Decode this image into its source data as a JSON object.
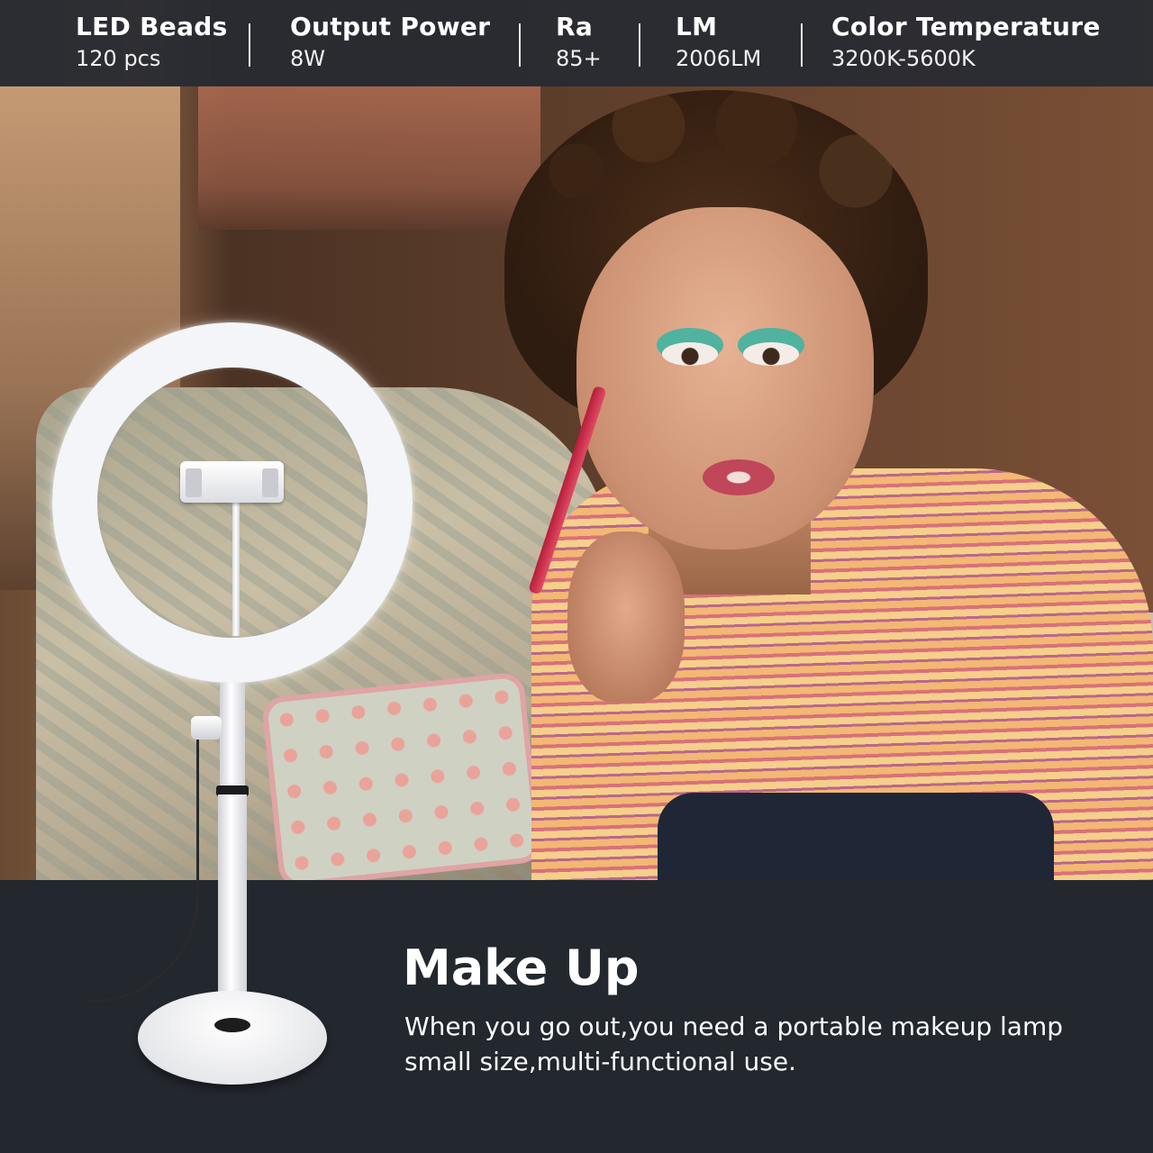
{
  "specs": [
    {
      "label": "LED Beads",
      "value": "120 pcs"
    },
    {
      "label": "Output Power",
      "value": "8W"
    },
    {
      "label": "Ra",
      "value": "85+"
    },
    {
      "label": "LM",
      "value": "2006LM"
    },
    {
      "label": "Color Temperature",
      "value": "3200K-5600K"
    }
  ],
  "headline": "Make Up",
  "description": {
    "line1": "When you go out,you need a portable makeup lamp",
    "line2": "small size,multi-functional use."
  },
  "colors": {
    "bar_background": "#262a32",
    "page_background": "#23272e",
    "text": "#ffffff",
    "ring_light": "#f4f5f8"
  }
}
